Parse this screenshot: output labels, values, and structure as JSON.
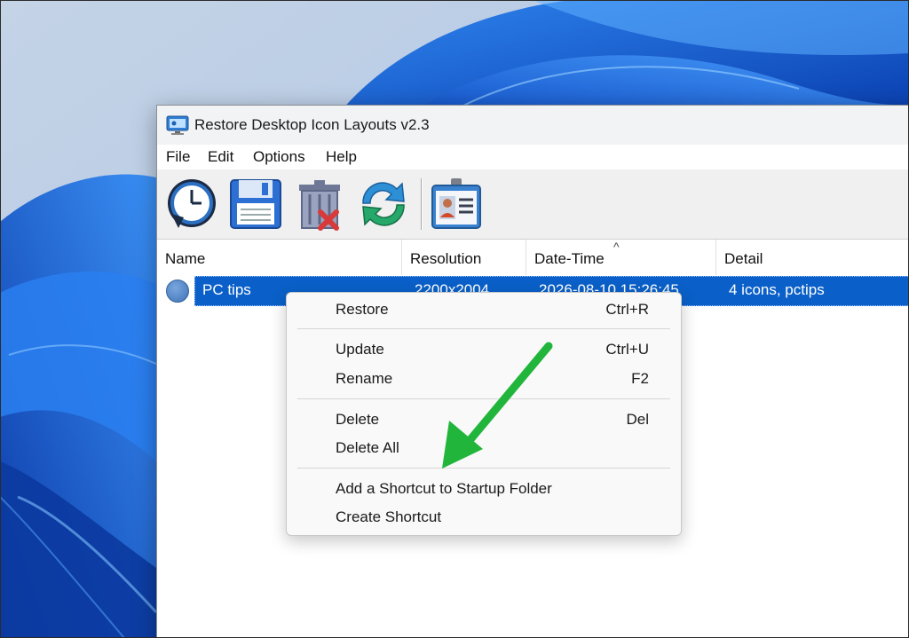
{
  "window": {
    "title": "Restore Desktop Icon Layouts v2.3",
    "icon": "monitor-app-icon"
  },
  "menubar": {
    "items": [
      "File",
      "Edit",
      "Options",
      "Help"
    ]
  },
  "toolbar": {
    "buttons": [
      {
        "icon": "clock-restore-icon"
      },
      {
        "icon": "floppy-save-icon"
      },
      {
        "icon": "trash-delete-icon"
      },
      {
        "icon": "refresh-icon"
      },
      {
        "icon": "id-card-icon"
      }
    ]
  },
  "list": {
    "columns": [
      "Name",
      "Resolution",
      "Date-Time",
      "Detail"
    ],
    "sort_indicator": "^",
    "rows": [
      {
        "name": "PC tips",
        "resolution": "2200x2004",
        "datetime": "2026-08-10 15:26:45",
        "detail": "4 icons, pctips",
        "selected": true
      }
    ]
  },
  "context_menu": {
    "items": [
      {
        "label": "Restore",
        "accel": "Ctrl+R"
      },
      {
        "label": "Update",
        "accel": "Ctrl+U"
      },
      {
        "label": "Rename",
        "accel": "F2"
      },
      {
        "label": "Delete",
        "accel": "Del"
      },
      {
        "label": "Delete All",
        "accel": ""
      },
      {
        "label": "Add a Shortcut to Startup Folder",
        "accel": ""
      },
      {
        "label": "Create Shortcut",
        "accel": ""
      }
    ]
  },
  "annotation": {
    "arrow_color": "#22b53c"
  },
  "colors": {
    "selection": "#0a60c8",
    "wallpaper_blue": "#1f6fe0"
  }
}
